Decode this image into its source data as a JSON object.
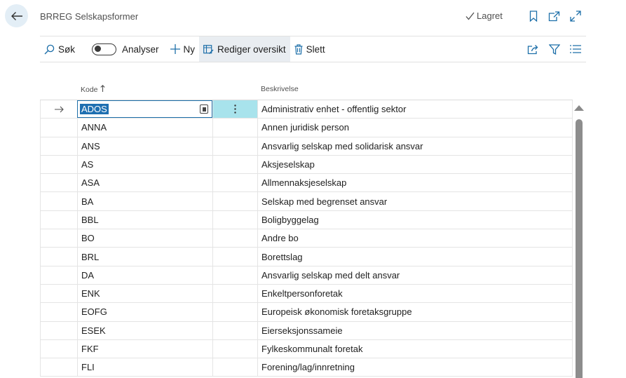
{
  "header": {
    "title": "BRREG Selskapsformer",
    "status": "Lagret"
  },
  "toolbar": {
    "search": "Søk",
    "analyze": "Analyser",
    "new": "Ny",
    "edit_list": "Rediger oversikt",
    "delete": "Slett"
  },
  "table": {
    "columns": {
      "code": "Kode",
      "description": "Beskrivelse"
    },
    "rows": [
      {
        "code": "ADOS",
        "description": "Administrativ enhet - offentlig sektor"
      },
      {
        "code": "ANNA",
        "description": "Annen juridisk person"
      },
      {
        "code": "ANS",
        "description": "Ansvarlig selskap med solidarisk ansvar"
      },
      {
        "code": "AS",
        "description": "Aksjeselskap"
      },
      {
        "code": "ASA",
        "description": "Allmennaksjeselskap"
      },
      {
        "code": "BA",
        "description": "Selskap med begrenset ansvar"
      },
      {
        "code": "BBL",
        "description": "Boligbyggelag"
      },
      {
        "code": "BO",
        "description": "Andre bo"
      },
      {
        "code": "BRL",
        "description": "Borettslag"
      },
      {
        "code": "DA",
        "description": "Ansvarlig selskap med delt ansvar"
      },
      {
        "code": "ENK",
        "description": "Enkeltpersonforetak"
      },
      {
        "code": "EOFG",
        "description": "Europeisk økonomisk foretaksgruppe"
      },
      {
        "code": "ESEK",
        "description": "Eierseksjonssameie"
      },
      {
        "code": "FKF",
        "description": "Fylkeskommunalt foretak"
      },
      {
        "code": "FLI",
        "description": "Forening/lag/innretning"
      }
    ]
  }
}
